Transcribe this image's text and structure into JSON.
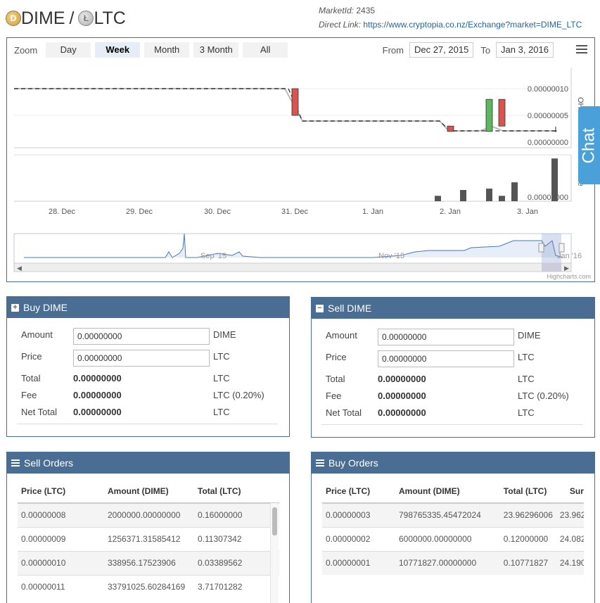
{
  "header": {
    "base_symbol": "DIME",
    "separator": "/",
    "quote_symbol": "LTC",
    "market_id_label": "MarketId:",
    "market_id": "2435",
    "direct_link_label": "Direct Link:",
    "direct_link": "https://www.cryptopia.co.nz/Exchange?market=DIME_LTC"
  },
  "chart": {
    "zoom_label": "Zoom",
    "zoom_buttons": [
      "Day",
      "Week",
      "Month",
      "3 Month",
      "All"
    ],
    "zoom_selected": "Week",
    "from_label": "From",
    "from_date": "Dec 27, 2015",
    "to_label": "To",
    "to_date": "Jan 3, 2016",
    "ohlc_axis_label": "OHLC",
    "volume_axis_label": "Volume",
    "price_ticks": [
      "0.00000010",
      "0.00000005",
      "0.00000000"
    ],
    "volume_ticks": [
      "0.00000000"
    ],
    "x_ticks": [
      "28. Dec",
      "29. Dec",
      "30. Dec",
      "31. Dec",
      "1. Jan",
      "2. Jan",
      "3. Jan"
    ],
    "navigator_labels": [
      "Sep '15",
      "Nov '15",
      "Jan '16"
    ],
    "credit": "Highcharts.com"
  },
  "chart_data": {
    "type": "candlestick",
    "price_ylim": [
      0,
      1e-07
    ],
    "candles": [
      {
        "x": "30 Dec",
        "open": 1e-07,
        "close": 5e-08,
        "color": "red"
      },
      {
        "x": "2 Jan",
        "open": 3e-08,
        "close": 2e-08,
        "color": "red"
      },
      {
        "x": "2 Jan",
        "open": 2e-08,
        "close": 8e-08,
        "color": "green"
      },
      {
        "x": "2 Jan",
        "open": 8e-08,
        "close": 3e-08,
        "color": "red"
      }
    ],
    "volumes": [
      {
        "x": "1 Jan",
        "value": 0.12
      },
      {
        "x": "2 Jan",
        "value": 0.25
      },
      {
        "x": "2 Jan",
        "value": 0.28
      },
      {
        "x": "2 Jan",
        "value": 0.12
      },
      {
        "x": "2 Jan",
        "value": 0.42
      },
      {
        "x": "3 Jan",
        "value": 0.95
      }
    ]
  },
  "chat_label": "Chat",
  "buy_panel": {
    "title": "Buy DIME",
    "amount_label": "Amount",
    "amount_value": "0.00000000",
    "amount_unit": "DIME",
    "price_label": "Price",
    "price_value": "0.00000000",
    "price_unit": "LTC",
    "total_label": "Total",
    "total_value": "0.00000000",
    "total_unit": "LTC",
    "fee_label": "Fee",
    "fee_value": "0.00000000",
    "fee_unit": "LTC (0.20%)",
    "net_label": "Net Total",
    "net_value": "0.00000000",
    "net_unit": "LTC"
  },
  "sell_panel": {
    "title": "Sell DIME",
    "amount_label": "Amount",
    "amount_value": "0.00000000",
    "amount_unit": "DIME",
    "price_label": "Price",
    "price_value": "0.00000000",
    "price_unit": "LTC",
    "total_label": "Total",
    "total_value": "0.00000000",
    "total_unit": "LTC",
    "fee_label": "Fee",
    "fee_value": "0.00000000",
    "fee_unit": "LTC (0.20%)",
    "net_label": "Net Total",
    "net_value": "0.00000000",
    "net_unit": "LTC"
  },
  "sell_orders": {
    "title": "Sell Orders",
    "columns": [
      "Price (LTC)",
      "Amount (DIME)",
      "Total (LTC)"
    ],
    "rows": [
      [
        "0.00000008",
        "2000000.00000000",
        "0.16000000"
      ],
      [
        "0.00000009",
        "1256371.31585412",
        "0.11307342"
      ],
      [
        "0.00000010",
        "338956.17523906",
        "0.03389562"
      ],
      [
        "0.00000011",
        "33791025.60284169",
        "3.71701282"
      ]
    ]
  },
  "buy_orders": {
    "title": "Buy Orders",
    "columns": [
      "Price (LTC)",
      "Amount (DIME)",
      "Total (LTC)",
      "Sur"
    ],
    "rows": [
      [
        "0.00000003",
        "798765335.45472024",
        "23.96296006",
        "23.962960"
      ],
      [
        "0.00000002",
        "6000000.00000000",
        "0.12000000",
        "24.082960"
      ],
      [
        "0.00000001",
        "10771827.00000000",
        "0.10771827",
        "24.190678"
      ]
    ]
  }
}
